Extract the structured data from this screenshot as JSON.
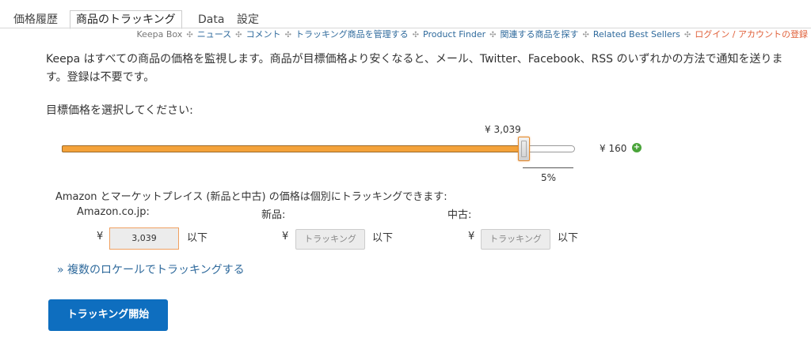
{
  "tabs": [
    {
      "label": "価格履歴",
      "active": false
    },
    {
      "label": "商品のトラッキング",
      "active": true
    },
    {
      "label": "Data",
      "active": false
    },
    {
      "label": "設定",
      "active": false
    }
  ],
  "subnav": {
    "links": [
      "Keepa Box",
      "ニュース",
      "コメント",
      "トラッキング商品を管理する",
      "Product Finder",
      "関連する商品を探す",
      "Related Best Sellers",
      "ログイン / アカウントの登録"
    ],
    "separator": "✣"
  },
  "intro": "Keepa はすべての商品の価格を監視します。商品が目標価格より安くなると、メール、Twitter、Facebook、RSS のいずれかの方法で通知を送ります。登録は不要です。",
  "select_label": "目標価格を選択してください:",
  "slider": {
    "value_label": "¥ 3,039",
    "max_label": "¥ 160",
    "plus_icon": "+",
    "discount_label": "5%",
    "position_fraction": 0.9
  },
  "marketplace_label": "Amazon とマーケットプレイス (新品と中古) の価格は個別にトラッキングできます:",
  "columns": [
    {
      "label": "Amazon.co.jp:",
      "currency": "¥",
      "value": "3,039",
      "suffix": "以下"
    },
    {
      "label": "新品:",
      "currency": "¥",
      "button": "トラッキング",
      "suffix": "以下"
    },
    {
      "label": "中古:",
      "currency": "¥",
      "button": "トラッキング",
      "suffix": "以下"
    }
  ],
  "multi_locale_link": "» 複数のロケールでトラッキングする",
  "start_button": "トラッキング開始",
  "colors": {
    "accent": "#f4a23a",
    "link": "#2f6a9c",
    "button": "#0e6ebf",
    "login": "#e0603a"
  }
}
